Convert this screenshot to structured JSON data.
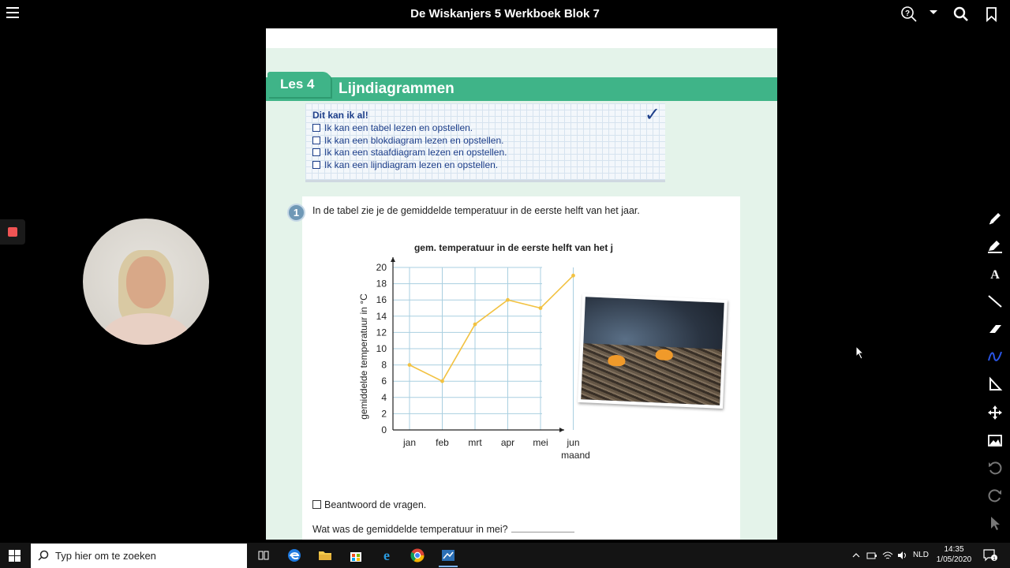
{
  "app": {
    "title": "De Wiskanjers 5 Werkboek Blok 7"
  },
  "lesson": {
    "tab": "Les 4",
    "title": "Lijndiagrammen"
  },
  "checklist": {
    "heading": "Dit kan ik al!",
    "items": [
      "Ik kan een tabel lezen en opstellen.",
      "Ik kan een blokdiagram lezen en opstellen.",
      "Ik kan een staafdiagram lezen en opstellen.",
      "Ik kan een lijndiagram lezen en opstellen."
    ]
  },
  "exercise": {
    "number": "1",
    "intro": "In de tabel zie je de gemiddelde temperatuur in de eerste helft van het jaar.",
    "task": "Beantwoord de vragen.",
    "question": "Wat was de gemiddelde temperatuur in mei?"
  },
  "chart_data": {
    "type": "line",
    "title": "gem. temperatuur in de eerste helft van het jaar",
    "xlabel": "maand",
    "ylabel": "gemiddelde temperatuur in °C",
    "categories": [
      "jan",
      "feb",
      "mrt",
      "apr",
      "mei",
      "jun"
    ],
    "values": [
      8,
      6,
      13,
      16,
      15,
      19
    ],
    "yticks": [
      "0",
      "2",
      "4",
      "6",
      "8",
      "10",
      "12",
      "14",
      "16",
      "18",
      "20"
    ],
    "ylim": [
      0,
      20
    ],
    "grid": true,
    "line_color": "#f2c242"
  },
  "taskbar": {
    "search_placeholder": "Typ hier om te zoeken",
    "language": "NLD",
    "time": "14:35",
    "date": "1/05/2020",
    "notifications": "1"
  },
  "icons": {
    "top": [
      "help-icon",
      "dropdown-icon",
      "search-icon",
      "bookmark-icon"
    ],
    "tools": [
      "pencil-icon",
      "highlighter-icon",
      "text-icon",
      "line-icon",
      "eraser-icon",
      "freehand-icon",
      "ruler-icon",
      "move-icon",
      "image-icon",
      "undo-icon",
      "redo-icon",
      "pointer-icon"
    ]
  }
}
